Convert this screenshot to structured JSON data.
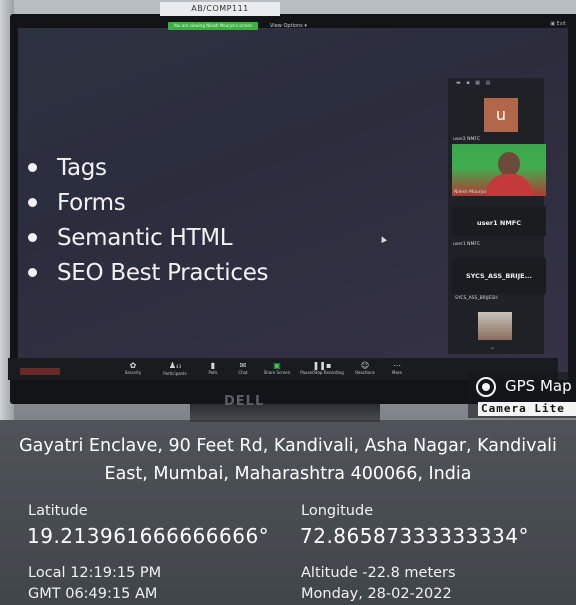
{
  "monitor": {
    "asset_label": "AB/COMP111",
    "brand": "DELL"
  },
  "meeting": {
    "share_banner": "You are viewing Nilesh Mourya's screen",
    "view_options": "View Options ▾",
    "top_right": "▣ Exit",
    "panel_icons": "▬ ▪ ▦ ▤",
    "slide_bullets": [
      "Tags",
      "Forms",
      "Semantic HTML",
      "SEO Best Practices"
    ],
    "participants": [
      {
        "avatar_letter": "u",
        "name": "user2 NMFC"
      },
      {
        "name": "Nilesh Mourya"
      },
      {
        "title": "user1 NMFC",
        "name": "user1 NMFC"
      },
      {
        "title": "SYCS_ASS_BRIJE...",
        "name": "SYCS_ASS_BRIJESH"
      }
    ],
    "toolbar": {
      "security": "Security",
      "participants": "Participants",
      "participants_count": "43",
      "polls": "Polls",
      "chat": "Chat",
      "share_screen": "Share Screen",
      "record": "Pause/Stop Recording",
      "reactions": "Reactions",
      "more": "More"
    }
  },
  "gps": {
    "app_title": "GPS Map",
    "app_subtitle": "Camera Lite",
    "address": "Gayatri Enclave, 90 Feet Rd, Kandivali, Asha Nagar, Kandivali East, Mumbai, Maharashtra 400066, India",
    "latitude_label": "Latitude",
    "latitude": "19.213961666666666°",
    "longitude_label": "Longitude",
    "longitude": "72.86587333333334°",
    "local_time": "Local 12:19:15 PM",
    "gmt_time": "GMT 06:49:15 AM",
    "altitude": "Altitude -22.8 meters",
    "date": "Monday, 28-02-2022"
  }
}
